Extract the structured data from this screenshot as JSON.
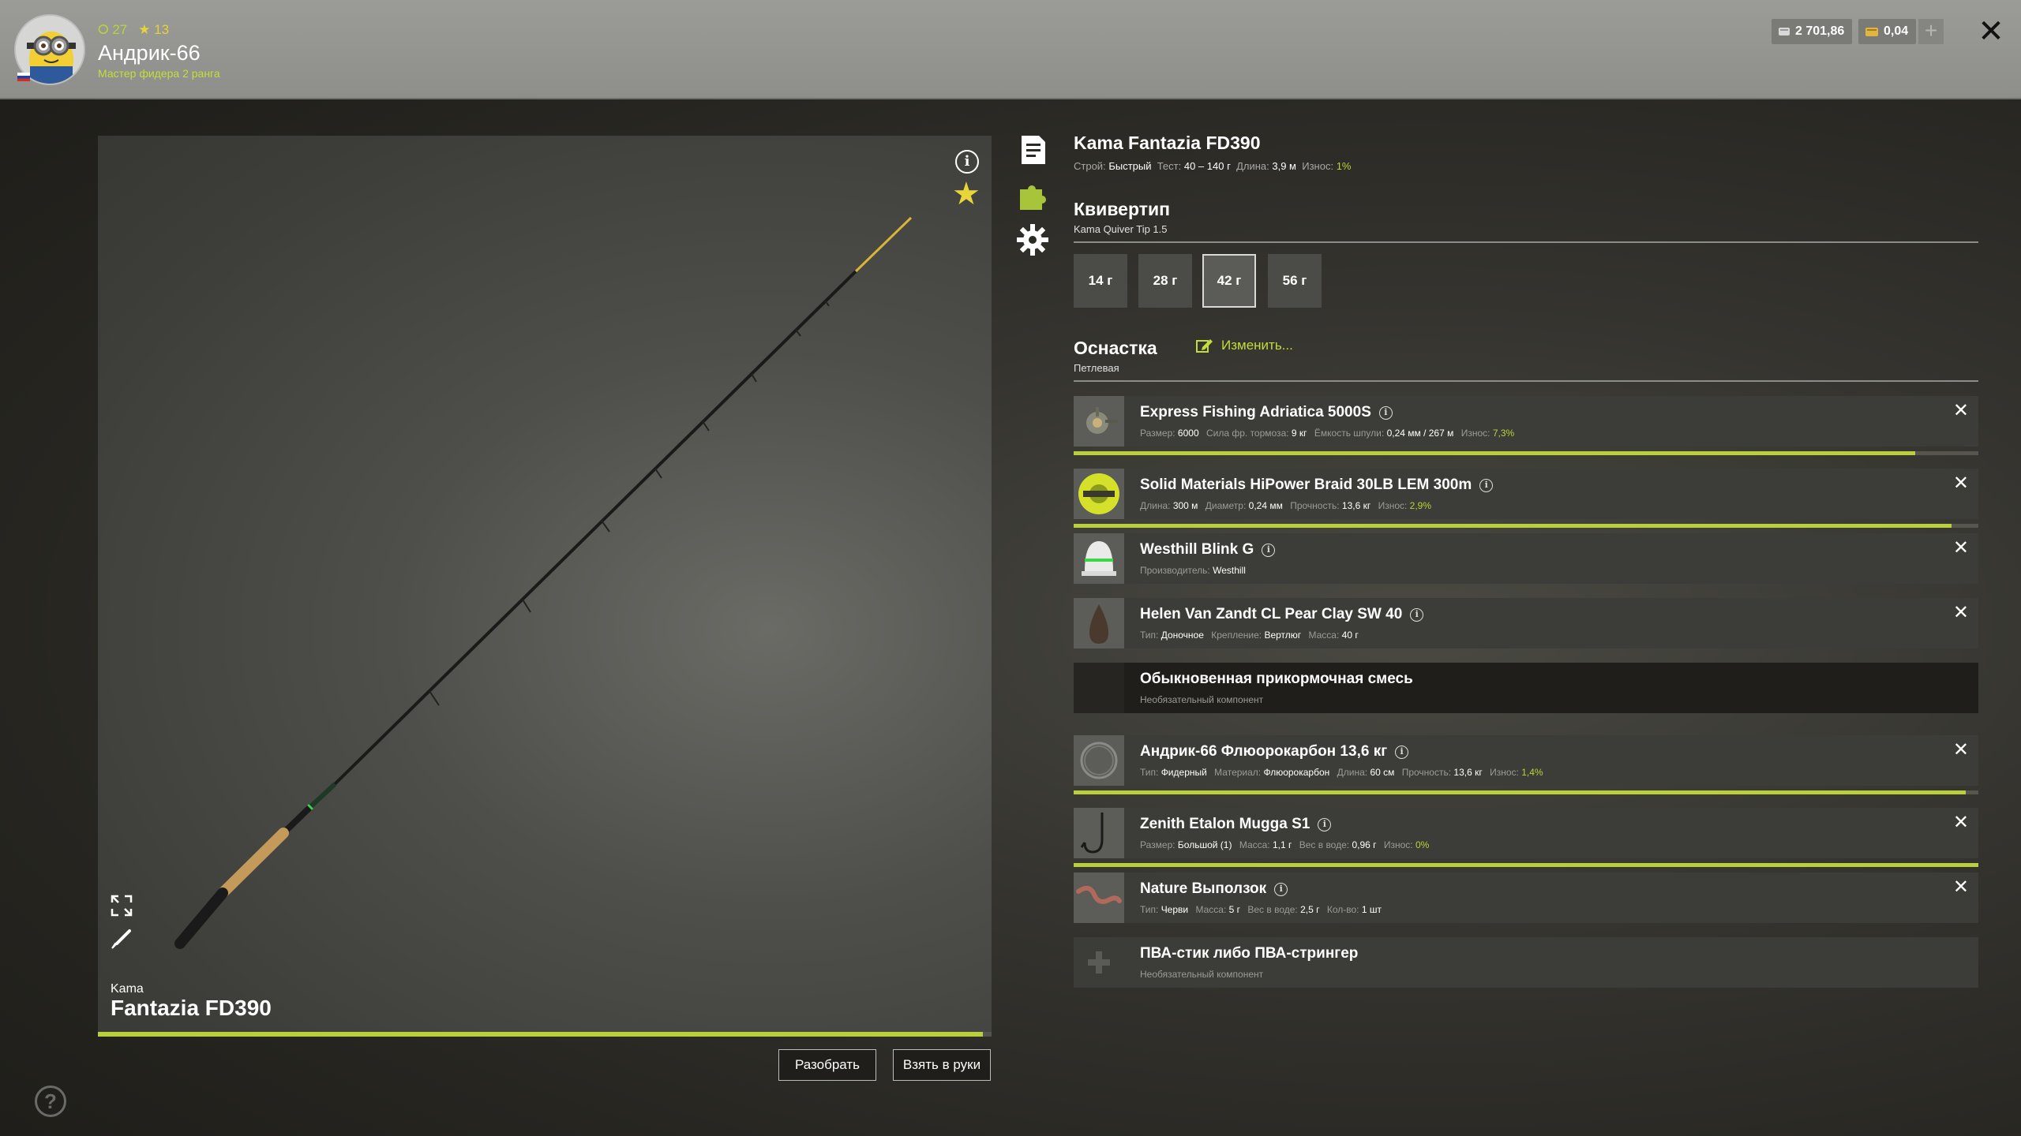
{
  "player": {
    "stat_level": "27",
    "stat_stars": "13",
    "name": "Андрик-66",
    "rank": "Мастер фидера 2 ранга"
  },
  "currency": {
    "silver": "2 701,86",
    "gold": "0,04",
    "add_label": "+"
  },
  "preview": {
    "brand": "Kama",
    "model": "Fantazia FD390",
    "wear_fraction": 0.99
  },
  "actions": {
    "disassemble": "Разобрать",
    "take": "Взять в руки"
  },
  "rod": {
    "title": "Kama Fantazia FD390",
    "props": [
      {
        "label": "Строй:",
        "value": "Быстрый"
      },
      {
        "label": "Тест:",
        "value": "40 – 140 г"
      },
      {
        "label": "Длина:",
        "value": "3,9 м"
      },
      {
        "label": "Износ:",
        "value": "1%"
      }
    ]
  },
  "quiver": {
    "title": "Квивертип",
    "subtitle": "Kama Quiver Tip 1.5",
    "options": [
      "14 г",
      "28 г",
      "42 г",
      "56 г"
    ],
    "selected_index": 2
  },
  "rig": {
    "title": "Оснастка",
    "subtitle": "Петлевая",
    "edit_label": "Изменить..."
  },
  "slots": [
    {
      "name": "Express Fishing Adriatica 5000S",
      "props": [
        {
          "label": "Размер:",
          "value": "6000"
        },
        {
          "label": "Сила фр. тормоза:",
          "value": "9 кг"
        },
        {
          "label": "Ёмкость шпули:",
          "value": "0,24 мм / 267 м"
        },
        {
          "label": "Износ:",
          "value": "7,3%"
        }
      ],
      "wear": 0.927
    },
    {
      "name": "Solid Materials HiPower Braid 30LB LEM 300m",
      "props": [
        {
          "label": "Длина:",
          "value": "300 м"
        },
        {
          "label": "Диаметр:",
          "value": "0,24 мм"
        },
        {
          "label": "Прочность:",
          "value": "13,6 кг"
        },
        {
          "label": "Износ:",
          "value": "2,9%"
        }
      ],
      "wear": 0.971
    },
    {
      "name": "Westhill Blink G",
      "props": [
        {
          "label": "Производитель:",
          "value": "Westhill"
        }
      ]
    },
    {
      "name": "Helen Van Zandt CL Pear Clay SW 40",
      "props": [
        {
          "label": "Тип:",
          "value": "Доночное"
        },
        {
          "label": "Крепление:",
          "value": "Вертлюг"
        },
        {
          "label": "Масса:",
          "value": "40 г"
        }
      ]
    },
    {
      "name": "Обыкновенная прикормочная смесь",
      "note": "Необязательный компонент"
    },
    {
      "name": "Андрик-66 Флюорокарбон 13,6 кг",
      "props": [
        {
          "label": "Тип:",
          "value": "Фидерный"
        },
        {
          "label": "Материал:",
          "value": "Флюорокарбон"
        },
        {
          "label": "Длина:",
          "value": "60 см"
        },
        {
          "label": "Прочность:",
          "value": "13,6 кг"
        },
        {
          "label": "Износ:",
          "value": "1,4%"
        }
      ],
      "wear": 0.986
    },
    {
      "name": "Zenith Etalon Mugga S1",
      "props": [
        {
          "label": "Размер:",
          "value": "Большой (1)"
        },
        {
          "label": "Масса:",
          "value": "1,1 г"
        },
        {
          "label": "Вес в воде:",
          "value": "0,96 г"
        },
        {
          "label": "Износ:",
          "value": "0%"
        }
      ],
      "wear": 1.0
    },
    {
      "name": "Nature Выползок",
      "props": [
        {
          "label": "Тип:",
          "value": "Черви"
        },
        {
          "label": "Масса:",
          "value": "5 г"
        },
        {
          "label": "Вес в воде:",
          "value": "2,5 г"
        },
        {
          "label": "Кол-во:",
          "value": "1 шт"
        }
      ]
    },
    {
      "name": "ПВА-стик либо ПВА-стрингер",
      "note": "Необязательный компонент"
    }
  ],
  "colors": {
    "accent_green": "#b9cf3c",
    "accent_yellow": "#e8d53a"
  }
}
